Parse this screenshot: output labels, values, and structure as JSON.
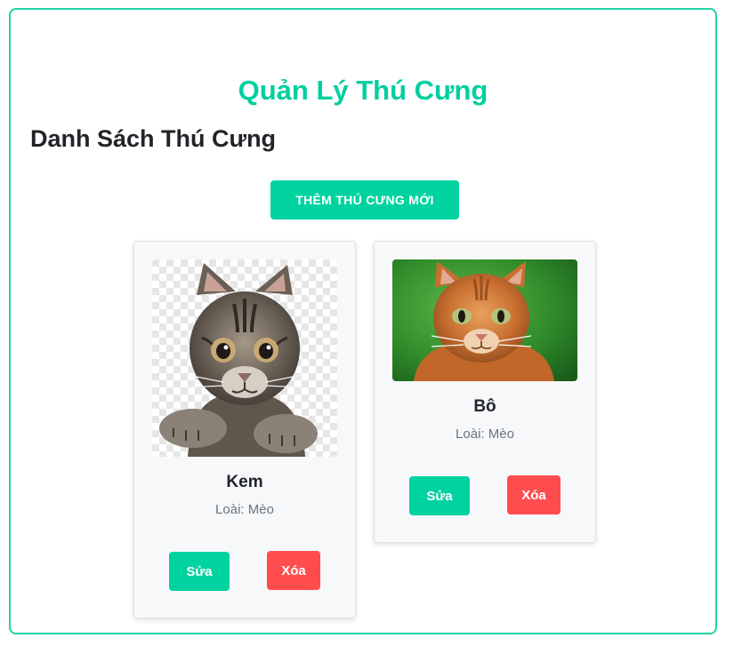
{
  "app": {
    "title": "Quản Lý Thú Cưng"
  },
  "list": {
    "heading": "Danh Sách Thú Cưng",
    "add_button_label": "THÊM THÚ CƯNG MỚI"
  },
  "pets": [
    {
      "name": "Kem",
      "species_label": "Loài:",
      "species_value": "Mèo",
      "edit_label": "Sửa",
      "delete_label": "Xóa",
      "photo": "tabby-cat-transparent-background"
    },
    {
      "name": "Bô",
      "species_label": "Loài:",
      "species_value": "Mèo",
      "edit_label": "Sửa",
      "delete_label": "Xóa",
      "photo": "orange-cat-green-background"
    }
  ],
  "colors": {
    "accent": "#00d3a0",
    "title": "#00cf9f",
    "danger": "#ff4d4f",
    "frame_border": "#1fd4a2",
    "muted_text": "#6c757d",
    "card_bg": "#f7f8fa"
  }
}
